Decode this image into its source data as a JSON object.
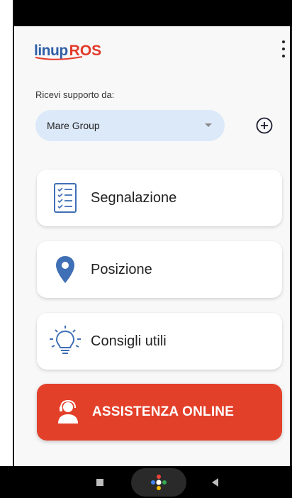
{
  "app": {
    "logo_brand": "linup",
    "logo_suffix": "ROS"
  },
  "support": {
    "label": "Ricevi supporto da:",
    "selected": "Mare Group"
  },
  "menu": {
    "items": [
      {
        "label": "Segnalazione",
        "icon": "checklist-icon"
      },
      {
        "label": "Posizione",
        "icon": "location-pin-icon"
      },
      {
        "label": "Consigli utili",
        "icon": "lightbulb-icon"
      }
    ]
  },
  "cta": {
    "label": "ASSISTENZA ONLINE",
    "icon": "headset-operator-icon"
  },
  "colors": {
    "brand_blue": "#2f5fa7",
    "brand_red": "#e23a2a",
    "cta_background": "#e3402a",
    "select_background": "#dce9f9"
  }
}
